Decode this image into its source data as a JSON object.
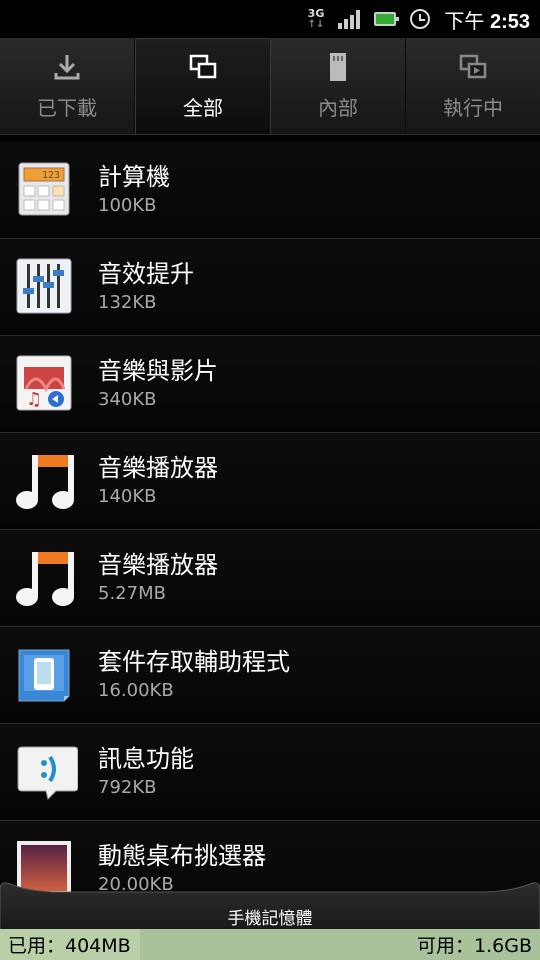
{
  "status": {
    "time_prefix": "下午",
    "time": "2:53",
    "network": "3G",
    "net_arrows": "↑↓"
  },
  "tabs": [
    {
      "label": "已下載",
      "icon": "download-icon",
      "active": false
    },
    {
      "label": "全部",
      "icon": "windows-icon",
      "active": true
    },
    {
      "label": "內部",
      "icon": "sdcard-icon",
      "active": false
    },
    {
      "label": "執行中",
      "icon": "running-icon",
      "active": false
    }
  ],
  "apps": [
    {
      "name": "計算機",
      "size": "100KB",
      "icon": "calculator-icon"
    },
    {
      "name": "音效提升",
      "size": "132KB",
      "icon": "equalizer-icon"
    },
    {
      "name": "音樂與影片",
      "size": "340KB",
      "icon": "music-video-icon"
    },
    {
      "name": "音樂播放器",
      "size": "140KB",
      "icon": "music-note-icon"
    },
    {
      "name": "音樂播放器",
      "size": "5.27MB",
      "icon": "music-note-icon"
    },
    {
      "name": "套件存取輔助程式",
      "size": "16.00KB",
      "icon": "package-access-icon"
    },
    {
      "name": "訊息功能",
      "size": "792KB",
      "icon": "messaging-icon"
    },
    {
      "name": "動態桌布挑選器",
      "size": "20.00KB",
      "icon": "live-wallpaper-icon"
    }
  ],
  "storage": {
    "title": "手機記憶體",
    "used": "已用：404MB",
    "available": "可用：1.6GB"
  }
}
